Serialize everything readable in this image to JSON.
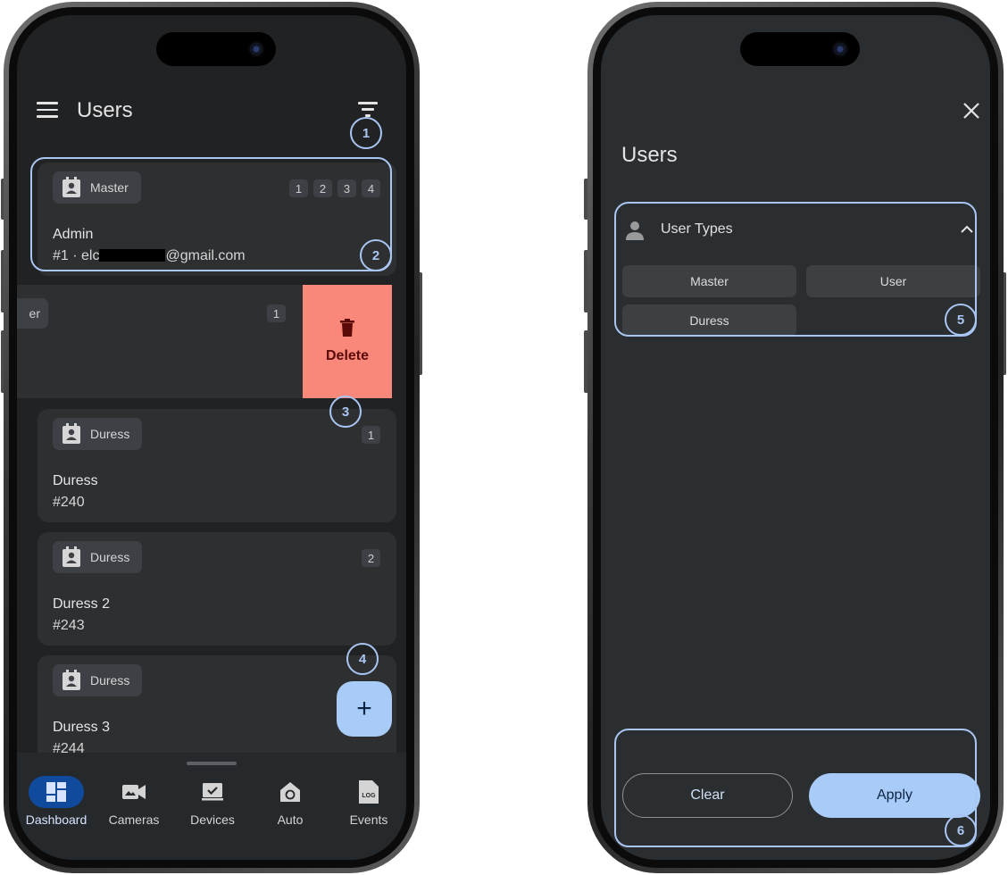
{
  "left_screen": {
    "app_bar": {
      "title": "Users"
    },
    "cards": [
      {
        "type": "Master",
        "slots": [
          "1",
          "2",
          "3",
          "4"
        ],
        "name": "Admin",
        "sub_prefix": "#1 · elc",
        "sub_suffix": "@gmail.com"
      },
      {
        "type": "Duress",
        "slots": [
          "1"
        ],
        "name": "Duress",
        "sub": "#240"
      },
      {
        "type": "Duress",
        "slots": [
          "2"
        ],
        "name": "Duress 2",
        "sub": "#243"
      },
      {
        "type": "Duress",
        "slots": [],
        "name": "Duress 3",
        "sub": "#244"
      }
    ],
    "swiped_row": {
      "chip_partial": "er",
      "slot": "1",
      "delete_label": "Delete"
    },
    "fab": {
      "label": "+"
    },
    "bottom_nav": [
      {
        "label": "Dashboard",
        "icon": "dashboard-icon",
        "active": true
      },
      {
        "label": "Cameras",
        "icon": "camera-icon",
        "active": false
      },
      {
        "label": "Devices",
        "icon": "devices-icon",
        "active": false
      },
      {
        "label": "Auto",
        "icon": "automation-icon",
        "active": false
      },
      {
        "label": "Events",
        "icon": "log-icon",
        "active": false
      }
    ]
  },
  "right_screen": {
    "title": "Users",
    "section": {
      "label": "User Types",
      "expanded": true
    },
    "options": [
      "Master",
      "User",
      "Duress"
    ],
    "buttons": {
      "clear": "Clear",
      "apply": "Apply"
    }
  },
  "annotations": [
    "1",
    "2",
    "3",
    "4",
    "5",
    "6"
  ],
  "colors": {
    "accent": "#a8cbf7",
    "nav_active": "#0f4a9c",
    "delete_bg": "#f9877a",
    "callout": "#a9c5f2",
    "screen_bg": "#212223"
  }
}
